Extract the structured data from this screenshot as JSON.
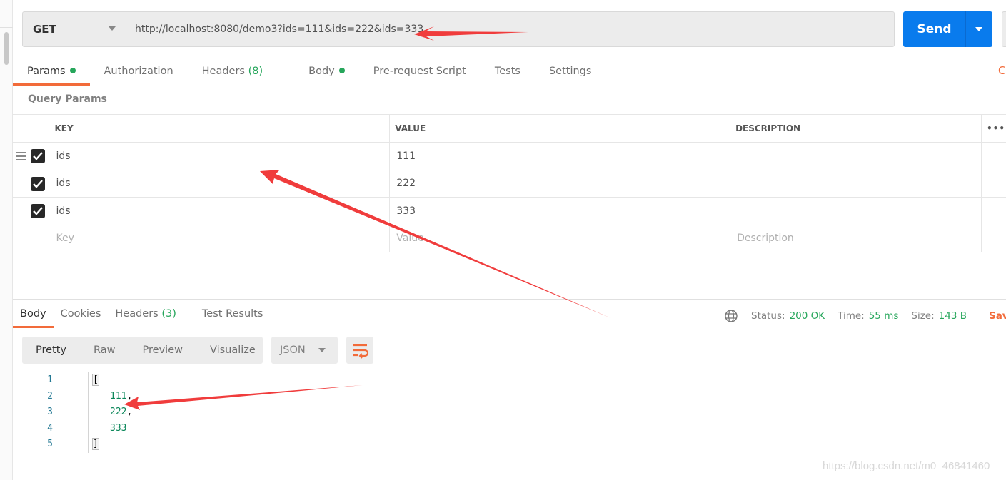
{
  "request": {
    "method": "GET",
    "url": "http://localhost:8080/demo3?ids=111&ids=222&ids=333",
    "send_label": "Send"
  },
  "request_tabs": [
    {
      "label": "Params",
      "dot": true
    },
    {
      "label": "Authorization"
    },
    {
      "label": "Headers",
      "count": "(8)"
    },
    {
      "label": "Body",
      "dot": true
    },
    {
      "label": "Pre-request Script"
    },
    {
      "label": "Tests"
    },
    {
      "label": "Settings"
    }
  ],
  "cut_off_link": "C",
  "query_params": {
    "title": "Query Params",
    "columns": [
      "KEY",
      "VALUE",
      "DESCRIPTION"
    ],
    "rows": [
      {
        "key": "ids",
        "value": "111",
        "checked": true
      },
      {
        "key": "ids",
        "value": "222",
        "checked": true
      },
      {
        "key": "ids",
        "value": "333",
        "checked": true
      }
    ],
    "placeholders": {
      "key": "Key",
      "value": "Value",
      "description": "Description"
    },
    "more": "•••"
  },
  "response": {
    "tabs": [
      {
        "label": "Body"
      },
      {
        "label": "Cookies"
      },
      {
        "label": "Headers",
        "count": "(3)"
      },
      {
        "label": "Test Results"
      }
    ],
    "status_label": "Status:",
    "status": "200 OK",
    "time_label": "Time:",
    "time": "55 ms",
    "size_label": "Size:",
    "size": "143 B",
    "save_label": "Save",
    "views": [
      "Pretty",
      "Raw",
      "Preview",
      "Visualize"
    ],
    "format": "JSON",
    "code": [
      {
        "n": "1",
        "t": "["
      },
      {
        "n": "2",
        "t": "111",
        "s": ","
      },
      {
        "n": "3",
        "t": "222",
        "s": ","
      },
      {
        "n": "4",
        "t": "333",
        "s": ""
      },
      {
        "n": "5",
        "t": "]"
      }
    ]
  },
  "colors": {
    "accent": "#f26b3a",
    "send": "#097bed",
    "success": "#26a65b",
    "annotation_arrow": "#f03c3c"
  },
  "watermark": "https://blog.csdn.net/m0_46841460"
}
